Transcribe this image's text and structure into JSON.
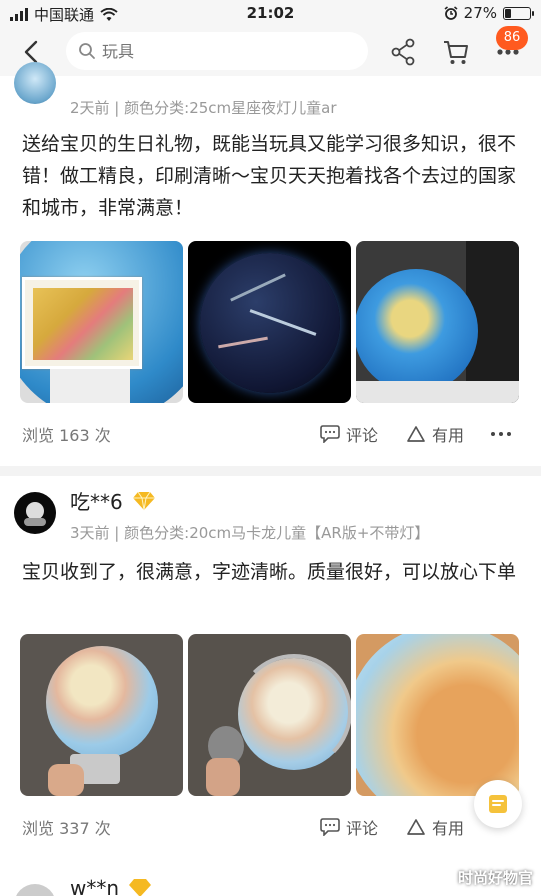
{
  "status_bar": {
    "carrier": "中国联通",
    "time": "21:02",
    "battery": "27%",
    "battery_level": 0.27
  },
  "nav": {
    "search_placeholder": "玩具",
    "cart_badge": "86"
  },
  "reviews": [
    {
      "username": "",
      "meta": "2天前 | 颜色分类:25cm星座夜灯儿童ar",
      "text": "送给宝贝的生日礼物，既能当玩具又能学习很多知识，很不错！做工精良，印刷清晰～宝贝天天抱着找各个去过的国家和城市，非常满意！",
      "views": "浏览 163 次",
      "comment_label": "评论",
      "like_label": "有用"
    },
    {
      "username": "吃**6",
      "meta": "3天前 | 颜色分类:20cm马卡龙儿童【AR版+不带灯】",
      "text": "宝贝收到了，很满意，字迹清晰。质量很好，可以放心下单",
      "views": "浏览 337 次",
      "comment_label": "评论",
      "like_label": "有用"
    },
    {
      "username": "w**n"
    }
  ],
  "watermark": "时尚好物官",
  "colors": {
    "accent": "#ff5a1f",
    "vip_badge": "#f5b922"
  }
}
